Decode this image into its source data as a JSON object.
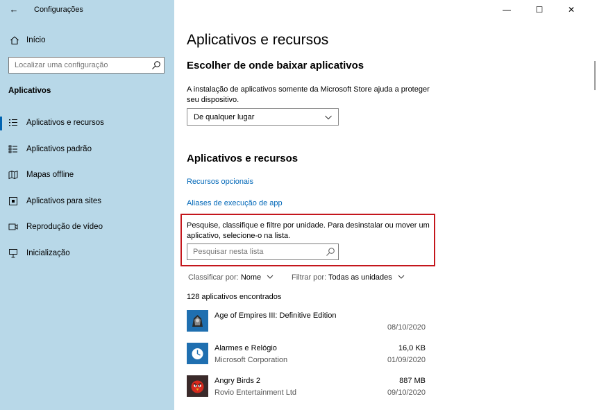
{
  "window": {
    "title": "Configurações",
    "back_glyph": "←",
    "minimize_glyph": "—",
    "maximize_glyph": "☐",
    "close_glyph": "✕"
  },
  "sidebar": {
    "home_label": "Início",
    "home_icon": "home-icon",
    "search_placeholder": "Localizar uma configuração",
    "section_label": "Aplicativos",
    "accent_color": "#0063b1",
    "items": [
      {
        "label": "Aplicativos e recursos",
        "icon": "list-icon",
        "selected": true
      },
      {
        "label": "Aplicativos padrão",
        "icon": "default-apps-icon",
        "selected": false
      },
      {
        "label": "Mapas offline",
        "icon": "map-icon",
        "selected": false
      },
      {
        "label": "Aplicativos para sites",
        "icon": "site-apps-icon",
        "selected": false
      },
      {
        "label": "Reprodução de vídeo",
        "icon": "video-icon",
        "selected": false
      },
      {
        "label": "Inicialização",
        "icon": "startup-icon",
        "selected": false
      }
    ]
  },
  "main": {
    "page_title": "Aplicativos e recursos",
    "install_source": {
      "heading": "Escolher de onde baixar aplicativos",
      "description": "A instalação de aplicativos somente da Microsoft Store ajuda a proteger seu dispositivo.",
      "dropdown_value": "De qualquer lugar"
    },
    "apps_section": {
      "heading": "Aplicativos e recursos",
      "link_optional": "Recursos opcionais",
      "link_aliases": "Aliases de execução de app",
      "search_description": "Pesquise, classifique e filtre por unidade. Para desinstalar ou mover um aplicativo, selecione-o na lista.",
      "search_placeholder": "Pesquisar nesta lista",
      "sort_label": "Classificar por:",
      "sort_value": "Nome",
      "filter_label": "Filtrar por:",
      "filter_value": "Todas as unidades",
      "count_text": "128 aplicativos encontrados",
      "highlight_color": "#c4161c",
      "link_color": "#0067b8"
    },
    "apps": [
      {
        "name": "Age of Empires III: Definitive Edition",
        "publisher": "",
        "size": "",
        "date": "08/10/2020",
        "icon": "age-of-empires-icon"
      },
      {
        "name": "Alarmes e Relógio",
        "publisher": "Microsoft Corporation",
        "size": "16,0 KB",
        "date": "01/09/2020",
        "icon": "alarm-clock-icon"
      },
      {
        "name": "Angry Birds 2",
        "publisher": "Rovio Entertainment Ltd",
        "size": "887 MB",
        "date": "09/10/2020",
        "icon": "angry-birds-icon"
      }
    ]
  }
}
